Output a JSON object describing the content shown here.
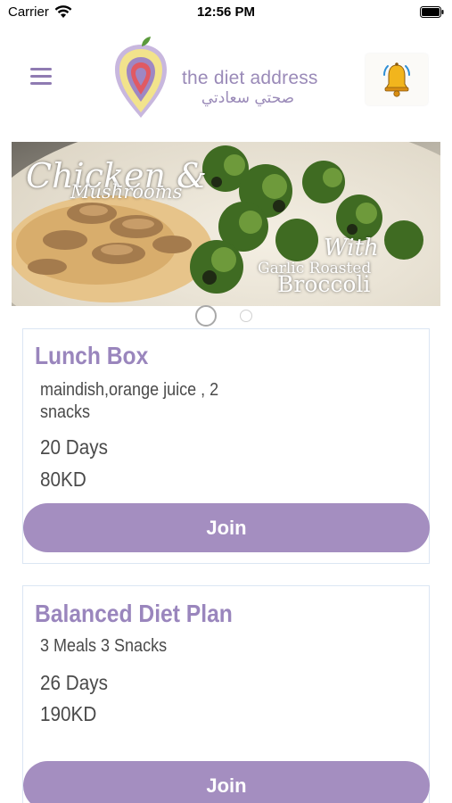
{
  "status_bar": {
    "carrier": "Carrier",
    "time": "12:56 PM"
  },
  "header": {
    "logo_text_en": "the diet address",
    "logo_text_ar": "صحتي سعادتي",
    "menu_icon": "hamburger-menu-icon",
    "notification_icon": "bell-icon"
  },
  "banner": {
    "line1": "Chicken &",
    "line2": "Mushrooms",
    "line3": "With",
    "line4": "Garlic Roasted",
    "line5": "Broccoli"
  },
  "carousel": {
    "active_index": 0,
    "count": 2
  },
  "plans": [
    {
      "title": "Lunch Box",
      "description": "maindish,orange juice , 2 snacks",
      "duration": "20 Days",
      "price": "80KD",
      "join_label": "Join"
    },
    {
      "title": "Balanced Diet Plan",
      "description": "3 Meals  3 Snacks",
      "duration": "26 Days",
      "price": "190KD",
      "join_label": "Join"
    }
  ],
  "colors": {
    "accent": "#a48ec0",
    "title": "#9a86bd",
    "card_border": "#dbe6f3"
  }
}
